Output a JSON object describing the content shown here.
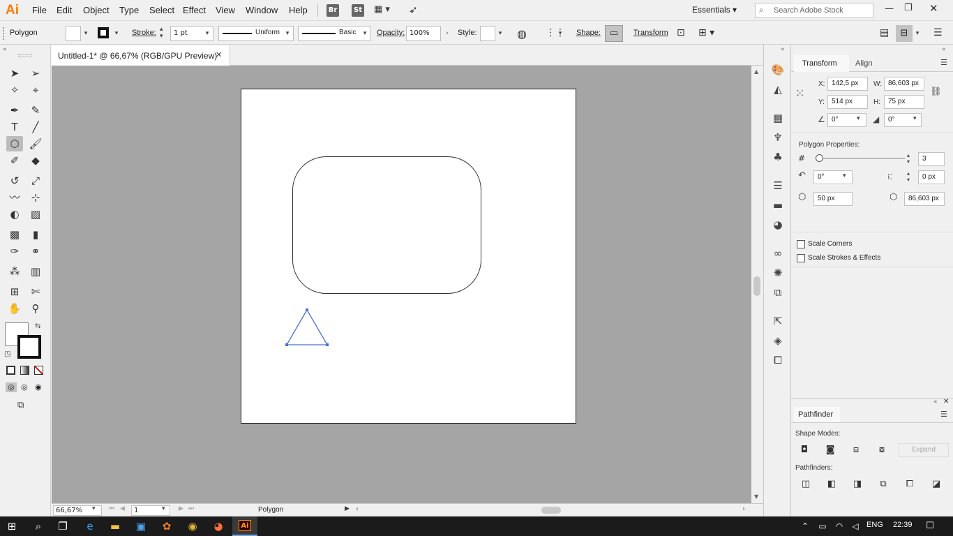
{
  "app": {
    "logo": "Ai"
  },
  "menu": [
    "File",
    "Edit",
    "Object",
    "Type",
    "Select",
    "Effect",
    "View",
    "Window",
    "Help"
  ],
  "bridge_buttons": [
    "Br",
    "St"
  ],
  "workspace": {
    "label": "Essentials"
  },
  "search": {
    "placeholder": "Search Adobe Stock"
  },
  "control_bar": {
    "object_type": "Polygon",
    "stroke_label": "Stroke:",
    "stroke_value": "1 pt",
    "profile_label": "Uniform",
    "brush_label": "Basic",
    "opacity_label": "Opacity:",
    "opacity_value": "100%",
    "style_label": "Style:",
    "shape_label": "Shape:",
    "transform_label": "Transform"
  },
  "document": {
    "tab_title": "Untitled-1* @ 66,67% (RGB/GPU Preview)"
  },
  "status": {
    "zoom": "66,67%",
    "artboard": "1",
    "tool": "Polygon"
  },
  "transform_panel": {
    "tabs": [
      "Transform",
      "Align"
    ],
    "x_label": "X:",
    "x_value": "142,5 px",
    "w_label": "W:",
    "w_value": "86,603 px",
    "y_label": "Y:",
    "y_value": "514 px",
    "h_label": "H:",
    "h_value": "75 px",
    "angle_value": "0°",
    "shear_value": "0°",
    "polygon_properties": "Polygon Properties:",
    "sides_value": "3",
    "rotation_value": "0°",
    "corner_value": "0 px",
    "radius_value": "50 px",
    "side_length_value": "86,603 px",
    "scale_corners": "Scale Corners",
    "scale_strokes": "Scale Strokes & Effects"
  },
  "pathfinder_panel": {
    "title": "Pathfinder",
    "shape_modes": "Shape Modes:",
    "expand": "Expand",
    "pathfinders": "Pathfinders:"
  },
  "taskbar": {
    "language": "ENG",
    "time": "22:39"
  },
  "colors": {
    "accent": "#ff7c00",
    "selection": "#4a6ed8",
    "canvas": "#a5a5a5"
  }
}
